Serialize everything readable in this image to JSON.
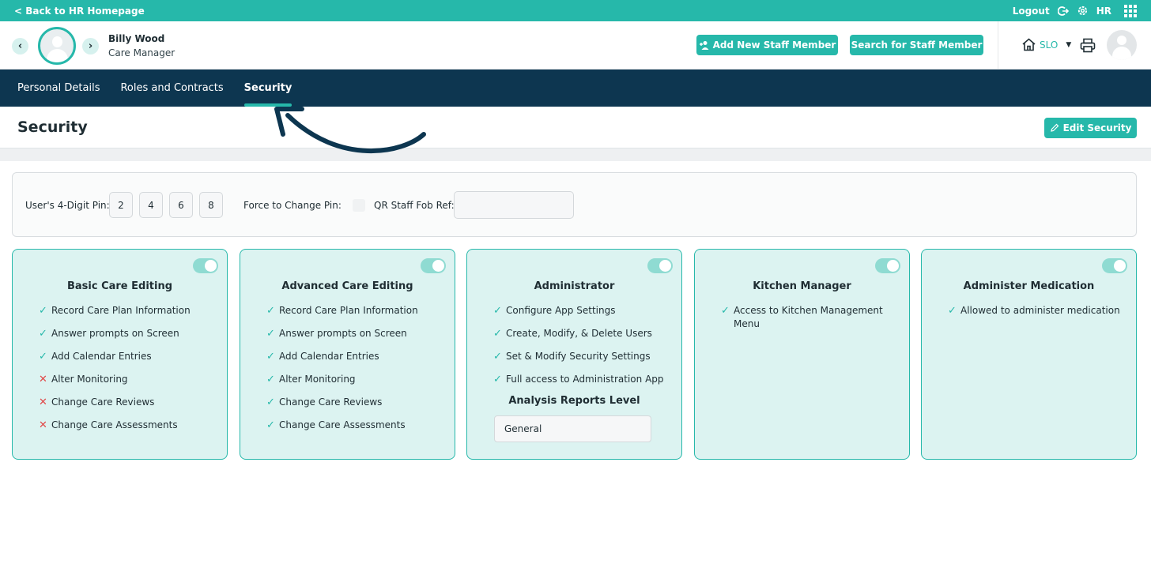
{
  "topbar": {
    "back_label": "< Back to HR Homepage",
    "logout": "Logout",
    "hr": "HR"
  },
  "header": {
    "name": "Billy Wood",
    "role": "Care Manager",
    "add_staff": "Add New Staff Member",
    "search_staff": "Search for Staff Member",
    "location": "SLO"
  },
  "tabs": [
    {
      "label": "Personal Details"
    },
    {
      "label": "Roles and Contracts"
    },
    {
      "label": "Security"
    }
  ],
  "section": {
    "title": "Security",
    "edit_label": "Edit Security"
  },
  "pin": {
    "label": "User's 4-Digit Pin:",
    "digits": [
      "2",
      "4",
      "6",
      "8"
    ],
    "force_label": "Force to Change Pin:",
    "qr_label": "QR Staff Fob Ref:",
    "qr_value": ""
  },
  "cards": [
    {
      "title": "Basic Care Editing",
      "items": [
        {
          "label": "Record Care Plan Information",
          "allowed": true
        },
        {
          "label": "Answer prompts on Screen",
          "allowed": true
        },
        {
          "label": "Add Calendar Entries",
          "allowed": true
        },
        {
          "label": "Alter Monitoring",
          "allowed": false
        },
        {
          "label": "Change Care Reviews",
          "allowed": false
        },
        {
          "label": "Change Care Assessments",
          "allowed": false
        }
      ]
    },
    {
      "title": "Advanced Care Editing",
      "items": [
        {
          "label": "Record Care Plan Information",
          "allowed": true
        },
        {
          "label": "Answer prompts on Screen",
          "allowed": true
        },
        {
          "label": "Add Calendar Entries",
          "allowed": true
        },
        {
          "label": "Alter Monitoring",
          "allowed": true
        },
        {
          "label": "Change Care Reviews",
          "allowed": true
        },
        {
          "label": "Change Care Assessments",
          "allowed": true
        }
      ]
    },
    {
      "title": "Administrator",
      "items": [
        {
          "label": "Configure App Settings",
          "allowed": true
        },
        {
          "label": "Create, Modify, & Delete Users",
          "allowed": true
        },
        {
          "label": "Set & Modify Security Settings",
          "allowed": true
        },
        {
          "label": "Full access to Administration App",
          "allowed": true
        }
      ],
      "sub_title": "Analysis Reports Level",
      "select_value": "General"
    },
    {
      "title": "Kitchen Manager",
      "items": [
        {
          "label": "Access to Kitchen Management Menu",
          "allowed": true
        }
      ]
    },
    {
      "title": "Administer Medication",
      "items": [
        {
          "label": "Allowed to administer medication",
          "allowed": true
        }
      ]
    }
  ],
  "colors": {
    "teal": "#26b8aa",
    "navy": "#0d3650",
    "card_bg": "#dcf3f1",
    "deny": "#e04848"
  },
  "icons": [
    "back-icon",
    "logout-icon",
    "gear-icon",
    "apps-grid-icon",
    "prev-arrow-icon",
    "next-arrow-icon",
    "add-user-icon",
    "home-icon",
    "print-icon",
    "pencil-icon",
    "check-icon",
    "cross-icon",
    "annotation-arrow"
  ]
}
